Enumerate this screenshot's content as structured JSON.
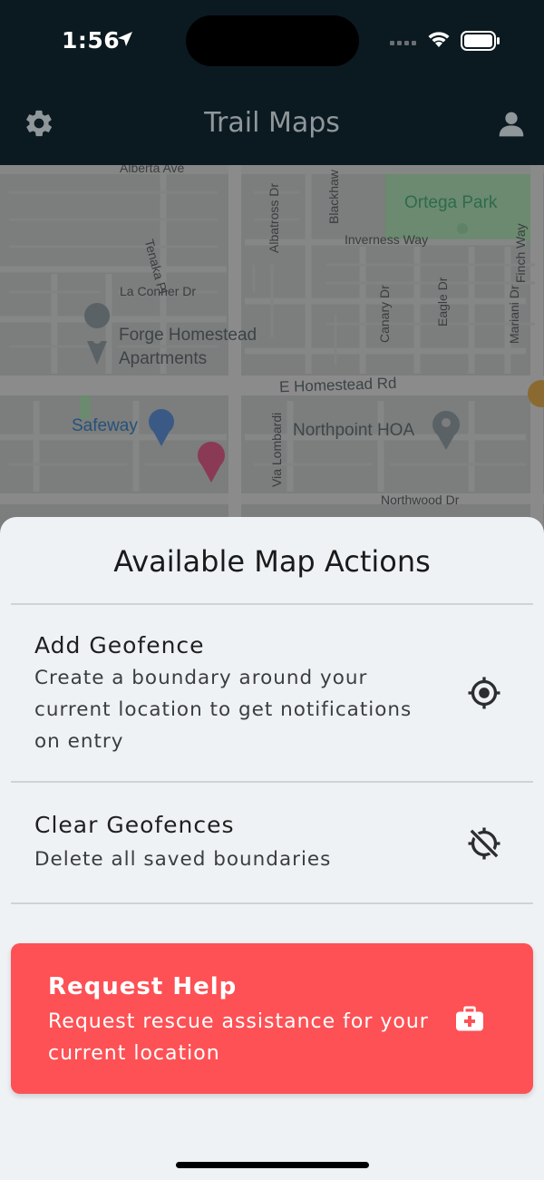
{
  "status_bar": {
    "time": "1:56"
  },
  "nav": {
    "title": "Trail Maps",
    "settings_icon": "gear-icon",
    "profile_icon": "person-icon"
  },
  "map": {
    "labels": {
      "alberta": "Alberta Ave",
      "tenaka": "Tenaka Pl",
      "albatross": "Albatross Dr",
      "blackhawk": "Blackhaw",
      "ortega": "Ortega Park",
      "inverness": "Inverness Way",
      "finch": "Finch Way",
      "laconner": "La Conner Dr",
      "canary": "Canary Dr",
      "eagle": "Eagle Dr",
      "mariani": "Mariani Dr",
      "forge_line1": "Forge Homestead",
      "forge_line2": "Apartments",
      "homestead": "E Homestead Rd",
      "safeway": "Safeway",
      "northpoint": "Northpoint HOA",
      "lombardi": "Via Lombardi",
      "northwood": "Northwood Dr"
    }
  },
  "sheet": {
    "title": "Available Map Actions",
    "actions": [
      {
        "title": "Add Geofence",
        "description": "Create a boundary around your current location to get notifications on entry",
        "icon": "crosshair-icon"
      },
      {
        "title": "Clear Geofences",
        "description": "Delete all saved boundaries",
        "icon": "location-off-icon"
      }
    ],
    "help": {
      "title": "Request Help",
      "description": "Request rescue assistance for your current location",
      "icon": "medical-kit-icon",
      "color": "#fd5155"
    }
  }
}
